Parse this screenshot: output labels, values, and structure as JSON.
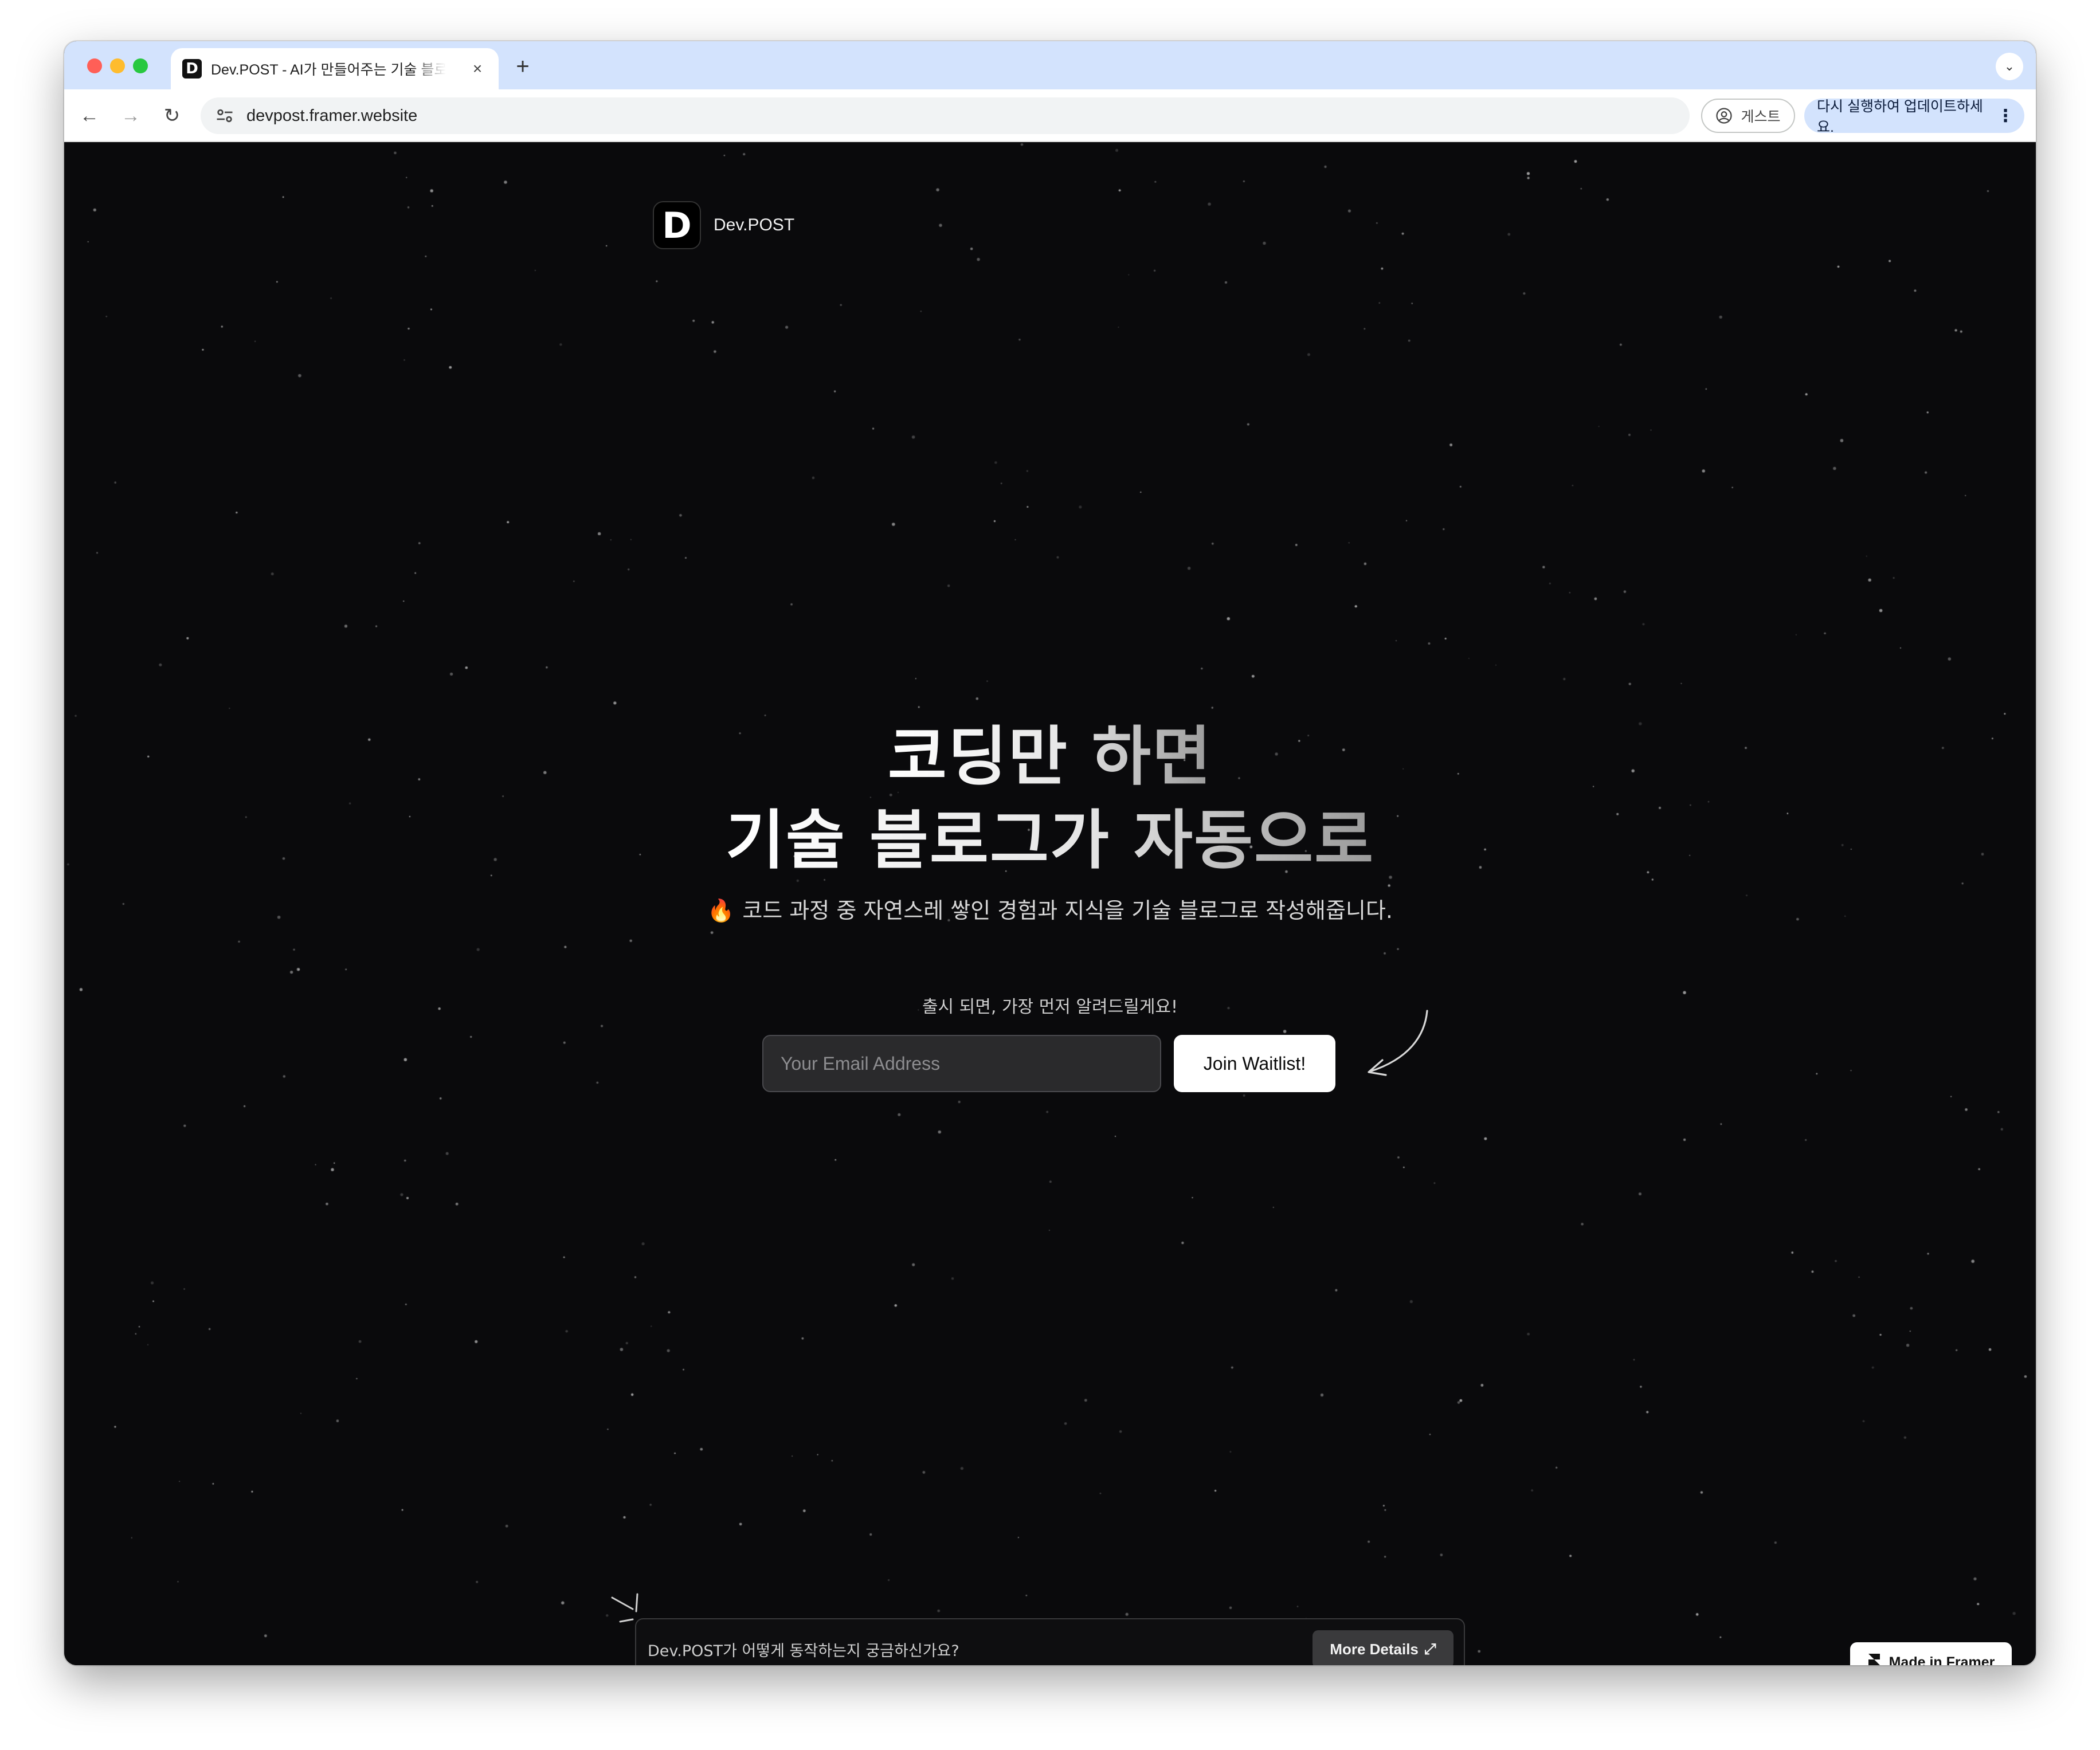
{
  "browser": {
    "tab": {
      "favicon": "D",
      "title": "Dev.POST - AI가 만들어주는 기술 블로그",
      "close": "×"
    },
    "new_tab": "+",
    "tab_menu": "⌄",
    "nav": {
      "back": "←",
      "forward": "→",
      "reload": "↻"
    },
    "url": "devpost.framer.website",
    "guest_label": "게스트",
    "update_label": "다시 실행하여 업데이트하세요.",
    "update_menu": "⋮"
  },
  "page": {
    "brand": {
      "logo": "D",
      "name": "Dev.POST"
    },
    "headline": {
      "line1": "코딩만 하면",
      "line2": "기술 블로그가 자동으로"
    },
    "subtitle": {
      "emoji": "🔥",
      "text": "코드 과정 중 자연스레 쌓인 경험과 지식을 기술 블로그로 작성해줍니다."
    },
    "waitlist": {
      "notice": "출시 되면, 가장 먼저 알려드릴게요!",
      "email_placeholder": "Your Email Address",
      "join_label": "Join Waitlist!"
    },
    "details": {
      "question": "Dev.POST가 어떻게 동작하는지 궁금하신가요?",
      "button_label": "More Details",
      "button_icon": "⤢"
    },
    "framer_badge": "Made in Framer"
  },
  "colors": {
    "page_background": "#0a0a0c",
    "tab_strip": "#d3e3fd",
    "input_background": "#2a2a2c",
    "button_background": "#ffffff",
    "accent_fire": "#ff7a1a"
  },
  "icons": [
    "close-icon",
    "plus-icon",
    "chevron-down-icon",
    "back-arrow-icon",
    "forward-arrow-icon",
    "reload-icon",
    "tune-icon",
    "account-icon",
    "kebab-menu-icon",
    "fire-icon",
    "curved-arrow-doodle",
    "spark-doodle",
    "expand-icon",
    "framer-icon"
  ]
}
